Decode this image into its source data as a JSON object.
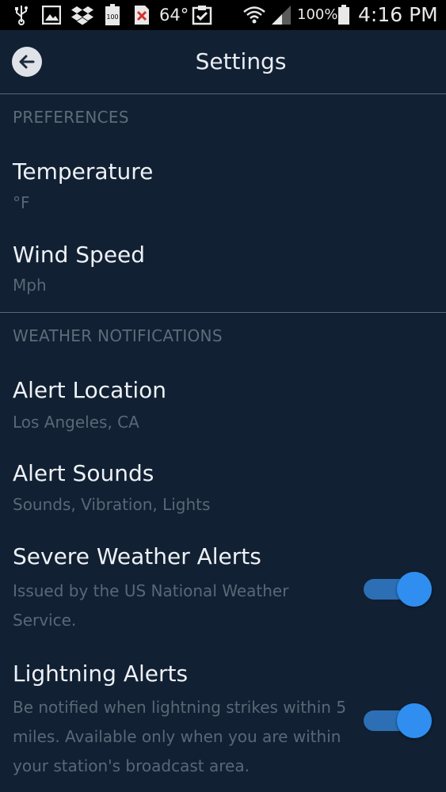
{
  "status_bar": {
    "temperature": "64°",
    "battery_percent": "100%",
    "time": "4:16 PM",
    "battery_badge": "100",
    "icons": [
      "usb-icon",
      "image-icon",
      "dropbox-icon",
      "battery-full-badge-icon",
      "error-icon",
      "clipboard-check-icon",
      "wifi-icon",
      "signal-icon",
      "battery-icon"
    ]
  },
  "app_bar": {
    "title": "Settings",
    "back_icon": "arrow-left-icon"
  },
  "preferences": {
    "header": "PREFERENCES",
    "items": [
      {
        "title": "Temperature",
        "value": "°F"
      },
      {
        "title": "Wind Speed",
        "value": "Mph"
      }
    ]
  },
  "notifications": {
    "header": "WEATHER NOTIFICATIONS",
    "items": [
      {
        "title": "Alert Location",
        "value": "Los Angeles, CA"
      },
      {
        "title": "Alert Sounds",
        "value": "Sounds, Vibration, Lights"
      },
      {
        "title": "Severe Weather Alerts",
        "description_line1": "Issued by the US National Weather",
        "description_line2": "Service.",
        "enabled": true
      },
      {
        "title": "Lightning Alerts",
        "description_line1": "Be notified when lightning strikes within 5",
        "description_line2": "miles. Available only when you are within",
        "description_line3": "your station's broadcast area.",
        "enabled": true
      }
    ]
  },
  "colors": {
    "background": "#112033",
    "accent": "#2f8ef0",
    "title_text": "#eef1f5",
    "secondary_text": "#5b6776"
  }
}
